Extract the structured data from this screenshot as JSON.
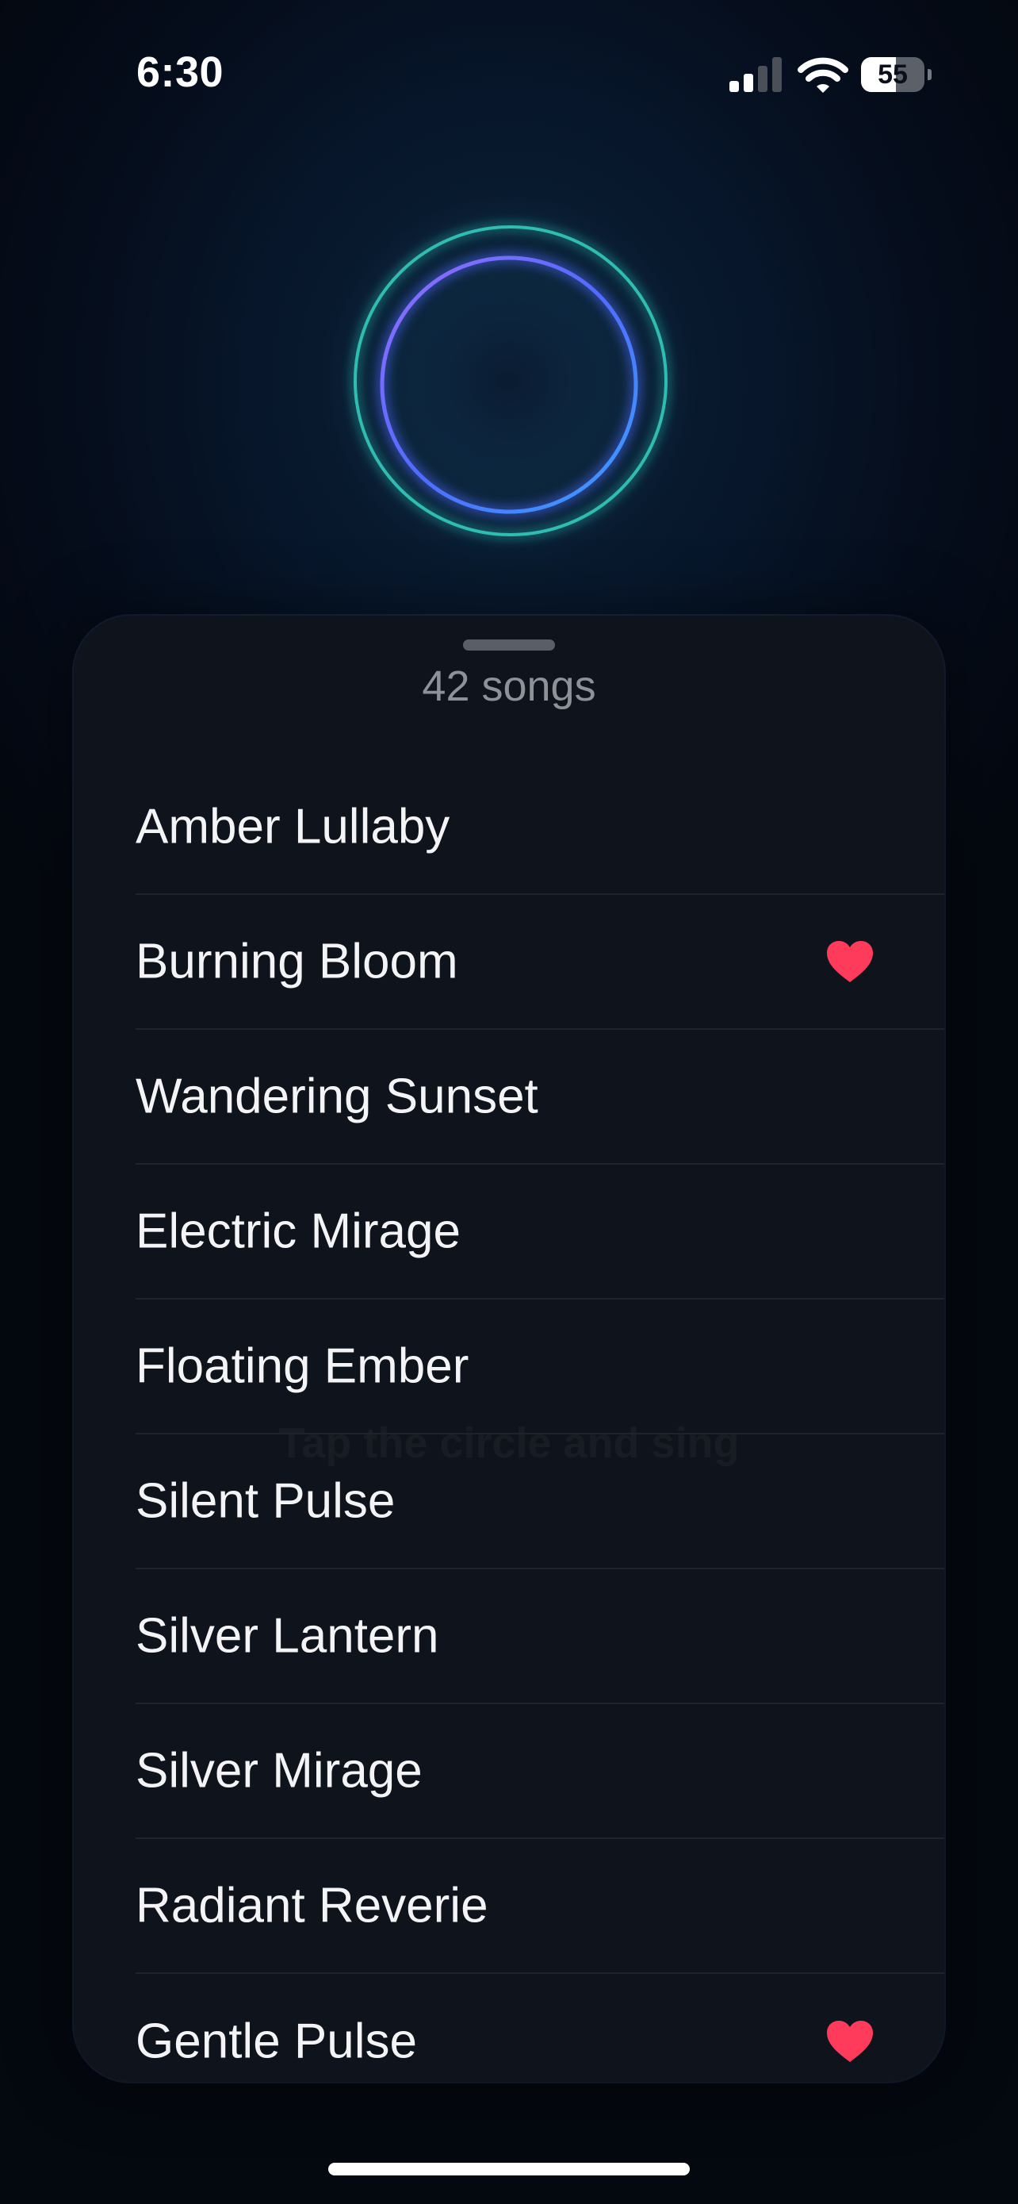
{
  "status_bar": {
    "time": "6:30",
    "battery_percent": "55",
    "battery_level": 0.55,
    "signal_bars_active": 2,
    "signal_bars_total": 4
  },
  "sheet": {
    "count_label": "42 songs",
    "background_hint": "Tap the circle and sing"
  },
  "songs": [
    {
      "title": "Amber Lullaby",
      "favorite": false
    },
    {
      "title": "Burning Bloom",
      "favorite": true
    },
    {
      "title": "Wandering Sunset",
      "favorite": false
    },
    {
      "title": "Electric Mirage",
      "favorite": false
    },
    {
      "title": "Floating Ember",
      "favorite": false
    },
    {
      "title": "Silent Pulse",
      "favorite": false
    },
    {
      "title": "Silver Lantern",
      "favorite": false
    },
    {
      "title": "Silver Mirage",
      "favorite": false
    },
    {
      "title": "Radiant Reverie",
      "favorite": false
    },
    {
      "title": "Gentle Pulse",
      "favorite": true
    }
  ],
  "icons": {
    "favorite": "heart-icon",
    "signal": "cellular-signal-icon",
    "wifi": "wifi-icon",
    "battery": "battery-icon"
  },
  "colors": {
    "heart": "#ff3b5c",
    "orb_teal": "#2ec4b6",
    "orb_blue": "#4f6bff",
    "orb_violet": "#8a5cf6",
    "sheet_bg": "#0f131b"
  }
}
